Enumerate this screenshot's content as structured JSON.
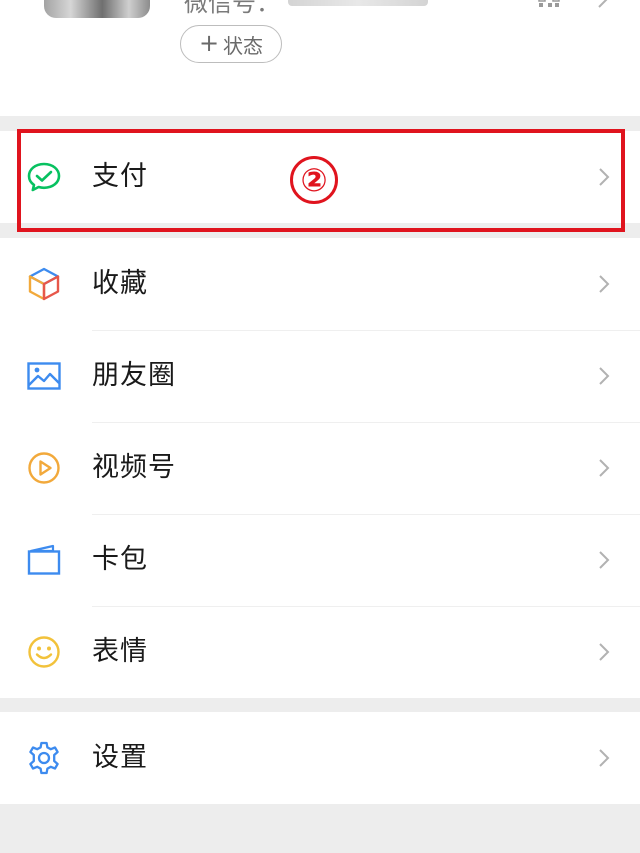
{
  "profile": {
    "wechat_id_label": "微信号：",
    "status_button_label": "状态",
    "status_plus": "+"
  },
  "pay_section": {
    "label": "支付",
    "icon": "wechat-pay-icon"
  },
  "menu": [
    {
      "label": "收藏",
      "icon": "favorites-cube-icon"
    },
    {
      "label": "朋友圈",
      "icon": "moments-image-icon"
    },
    {
      "label": "视频号",
      "icon": "channels-play-icon"
    },
    {
      "label": "卡包",
      "icon": "card-wallet-icon"
    },
    {
      "label": "表情",
      "icon": "sticker-smile-icon"
    }
  ],
  "settings": {
    "label": "设置",
    "icon": "settings-gear-icon"
  },
  "annotation": {
    "step": "②",
    "color": "#e0141e"
  },
  "colors": {
    "page_background": "#ededed",
    "card_background": "#ffffff",
    "pay_green": "#07c160",
    "chevron": "#b2b2b2"
  }
}
